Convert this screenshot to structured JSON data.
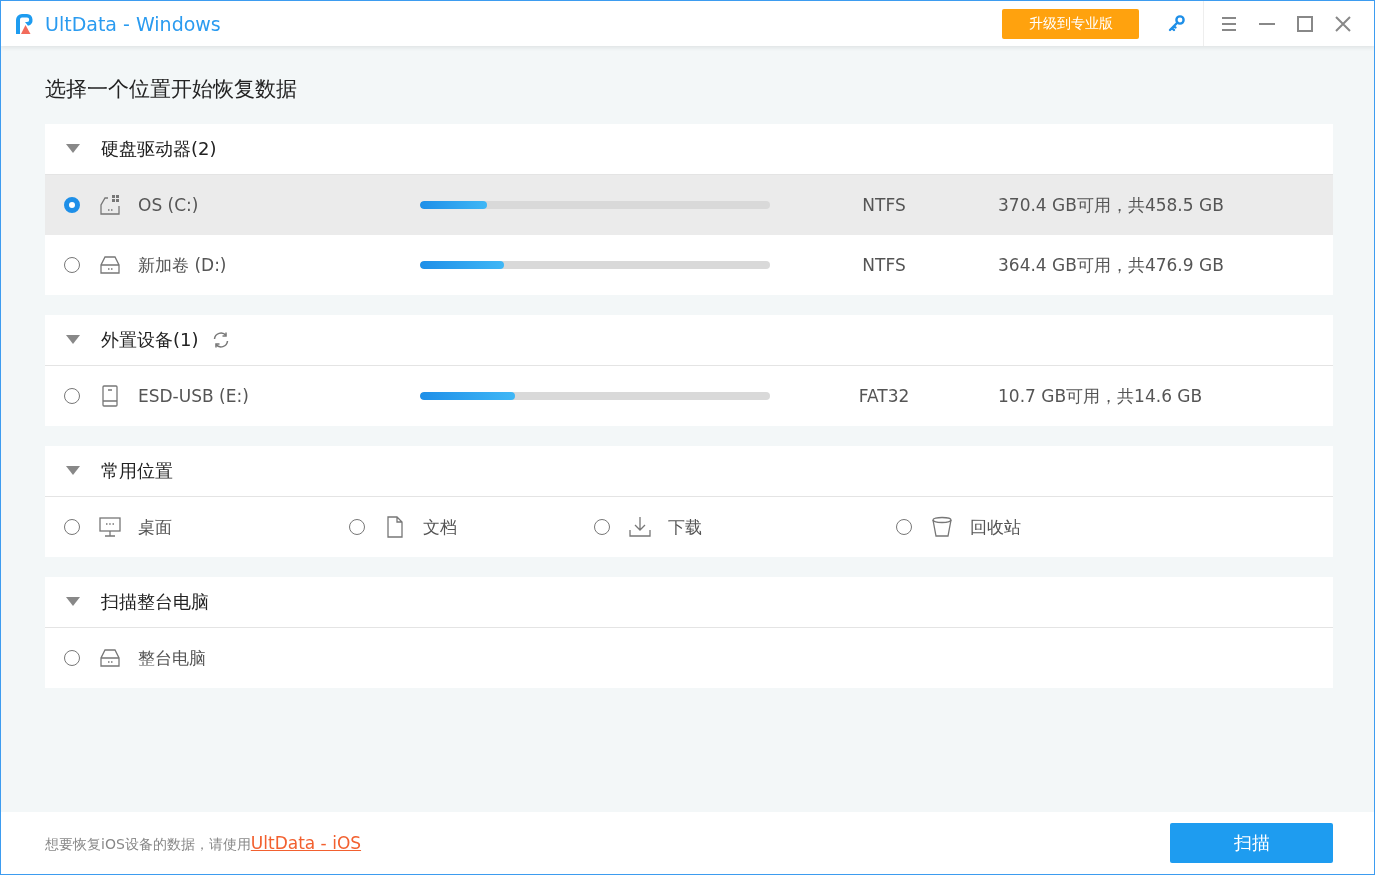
{
  "window": {
    "title": "UltData - Windows"
  },
  "upgrade_button": "升级到专业版",
  "heading": "选择一个位置开始恢复数据",
  "sections": [
    {
      "title": "硬盘驱动器(2)",
      "expanded": true,
      "refreshable": false,
      "kind": "rows",
      "items": [
        {
          "kind": "windows-drive",
          "name": "OS (C:)",
          "level": 0.19,
          "filesystem": "NTFS",
          "space": "370.4 GB可用，共458.5 GB",
          "selected": true
        },
        {
          "kind": "drive",
          "name": "新加卷 (D:)",
          "level": 0.24,
          "filesystem": "NTFS",
          "space": "364.4 GB可用，共476.9 GB",
          "selected": false
        }
      ]
    },
    {
      "title": "外置设备(1)",
      "expanded": true,
      "refreshable": true,
      "kind": "rows",
      "items": [
        {
          "kind": "usb",
          "name": "ESD-USB (E:)",
          "level": 0.27,
          "filesystem": "FAT32",
          "space": "10.7 GB可用，共14.6 GB",
          "selected": false
        }
      ]
    },
    {
      "title": "常用位置",
      "expanded": true,
      "refreshable": false,
      "kind": "grid",
      "items": [
        {
          "kind": "desktop",
          "name": "桌面",
          "selected": false
        },
        {
          "kind": "document",
          "name": "文档",
          "selected": false
        },
        {
          "kind": "download",
          "name": "下载",
          "selected": false
        },
        {
          "kind": "recycle",
          "name": "回收站",
          "selected": false
        }
      ]
    },
    {
      "title": "扫描整台电脑",
      "expanded": true,
      "refreshable": false,
      "kind": "rows",
      "items": [
        {
          "kind": "drive",
          "name": "整台电脑",
          "selected": false
        }
      ]
    }
  ],
  "footer": {
    "hint": "想要恢复iOS设备的数据，请使用",
    "link": "UltData - iOS",
    "scan_button": "扫描"
  }
}
